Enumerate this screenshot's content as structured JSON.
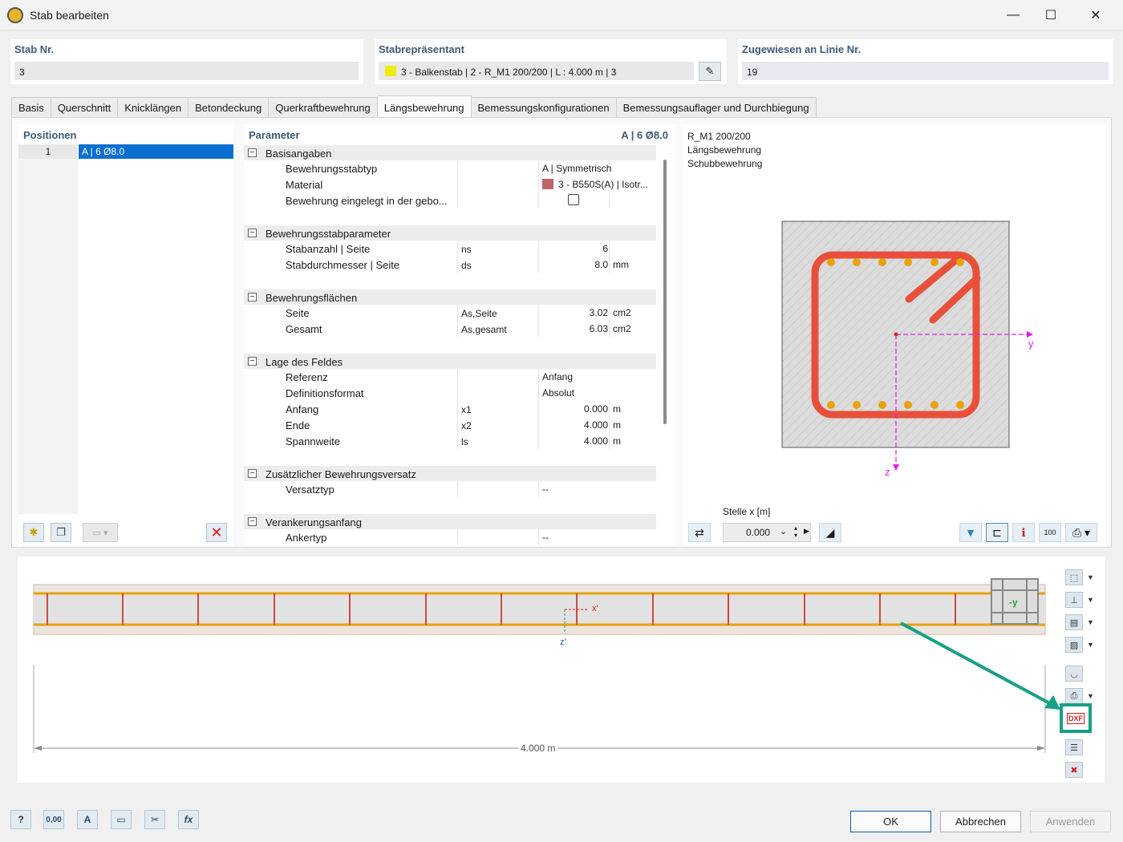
{
  "window": {
    "title": "Stab bearbeiten",
    "minimize": "—",
    "maximize": "☐",
    "close": "✕"
  },
  "header": {
    "member_no_label": "Stab Nr.",
    "member_no_value": "3",
    "representative_label": "Stabrepräsentant",
    "representative_value": "3 - Balkenstab | 2 - R_M1 200/200 | L : 4.000 m | 3",
    "assigned_label": "Zugewiesen an Linie Nr.",
    "assigned_value": "19"
  },
  "tabs": [
    "Basis",
    "Querschnitt",
    "Knicklängen",
    "Betondeckung",
    "Querkraftbewehrung",
    "Längsbewehrung",
    "Bemessungskonfigurationen",
    "Bemessungsauflager und Durchbiegung"
  ],
  "positions": {
    "title": "Positionen",
    "rows": [
      {
        "no": "1",
        "label": "A | 6 Ø8.0"
      }
    ]
  },
  "parameters": {
    "title": "Parameter",
    "selected": "A | 6 Ø8.0",
    "groups": [
      {
        "name": "Basisangaben",
        "rows": [
          {
            "name": "Bewehrungsstabtyp",
            "sym": "",
            "value": "A | Symmetrisch",
            "unit": ""
          },
          {
            "name": "Material",
            "sym": "",
            "value": "3 - B550S(A) | Isotr...",
            "unit": ""
          },
          {
            "name": "Bewehrung eingelegt in der gebo...",
            "sym": "",
            "value": "",
            "unit": ""
          }
        ]
      },
      {
        "name": "Bewehrungsstabparameter",
        "rows": [
          {
            "name": "Stabanzahl | Seite",
            "sym": "ns",
            "value": "6",
            "unit": ""
          },
          {
            "name": "Stabdurchmesser | Seite",
            "sym": "ds",
            "value": "8.0",
            "unit": "mm"
          }
        ]
      },
      {
        "name": "Bewehrungsflächen",
        "rows": [
          {
            "name": "Seite",
            "sym": "As,Seite",
            "value": "3.02",
            "unit": "cm2"
          },
          {
            "name": "Gesamt",
            "sym": "As,gesamt",
            "value": "6.03",
            "unit": "cm2"
          }
        ]
      },
      {
        "name": "Lage des Feldes",
        "rows": [
          {
            "name": "Referenz",
            "sym": "",
            "value": "Anfang",
            "unit": ""
          },
          {
            "name": "Definitionsformat",
            "sym": "",
            "value": "Absolut",
            "unit": ""
          },
          {
            "name": "Anfang",
            "sym": "x1",
            "value": "0.000",
            "unit": "m"
          },
          {
            "name": "Ende",
            "sym": "x2",
            "value": "4.000",
            "unit": "m"
          },
          {
            "name": "Spannweite",
            "sym": "ls",
            "value": "4.000",
            "unit": "m"
          }
        ]
      },
      {
        "name": "Zusätzlicher Bewehrungsversatz",
        "rows": [
          {
            "name": "Versatztyp",
            "sym": "",
            "value": "--",
            "unit": ""
          }
        ]
      },
      {
        "name": "Verankerungsanfang",
        "rows": [
          {
            "name": "Ankertyp",
            "sym": "",
            "value": "--",
            "unit": ""
          }
        ]
      }
    ]
  },
  "section": {
    "info": [
      "R_M1 200/200",
      "Längsbewehrung",
      "Schubbewehrung"
    ],
    "axis_y": "y",
    "axis_z": "z",
    "stelle_label": "Stelle x [m]",
    "stelle_value": "0.000"
  },
  "longitudinal": {
    "axis_x": "x'",
    "axis_z": "z'",
    "dimension": "4.000 m",
    "view_label": "-y"
  },
  "buttons": {
    "ok": "OK",
    "cancel": "Abbrechen",
    "apply": "Anwenden"
  },
  "bottom_icons": {
    "units": "0,00",
    "fx": "fx"
  },
  "colors": {
    "rebar": "#e8503a",
    "bar_dot": "#e8a20a",
    "axis": "#e020e0",
    "highlight": "#16a085",
    "material": "#c0636b",
    "representative": "#ecf000"
  }
}
